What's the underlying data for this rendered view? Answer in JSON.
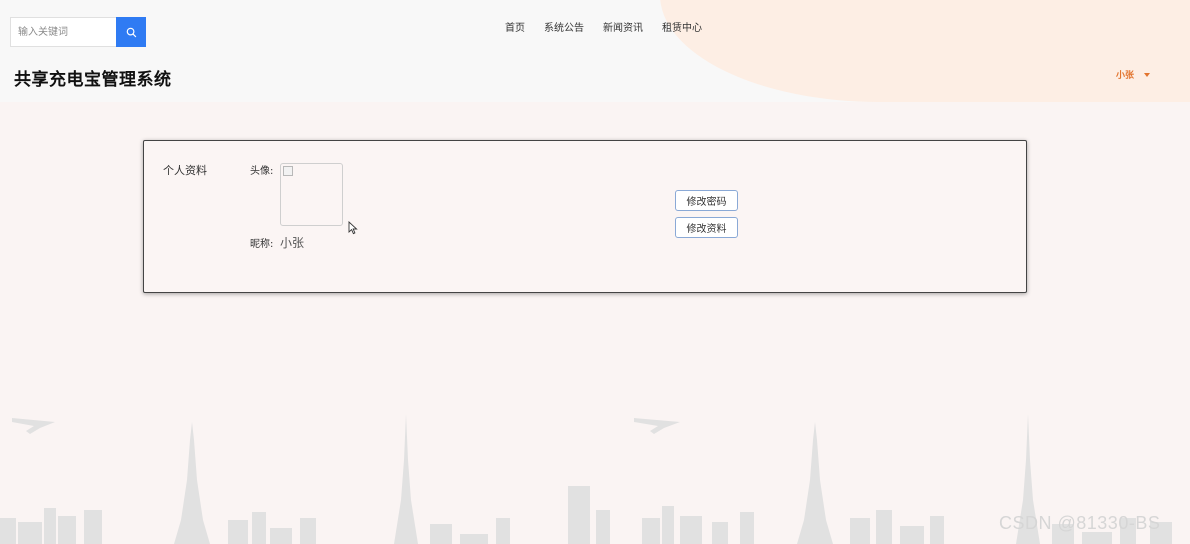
{
  "search": {
    "placeholder": "输入关键词"
  },
  "nav": {
    "items": [
      "首页",
      "系统公告",
      "新闻资讯",
      "租赁中心"
    ]
  },
  "site": {
    "title": "共享充电宝管理系统"
  },
  "user": {
    "name": "小张"
  },
  "profile": {
    "title": "个人资料",
    "avatar_label": "头像:",
    "nickname_label": "昵称:",
    "nickname_value": "小张",
    "change_password_label": "修改密码",
    "edit_profile_label": "修改资料"
  },
  "watermark": "CSDN @81330-BS",
  "colors": {
    "accent": "#2f7bf3",
    "user": "#e2742e",
    "header_blob": "#fdeee4",
    "background": "#faf4f3"
  }
}
